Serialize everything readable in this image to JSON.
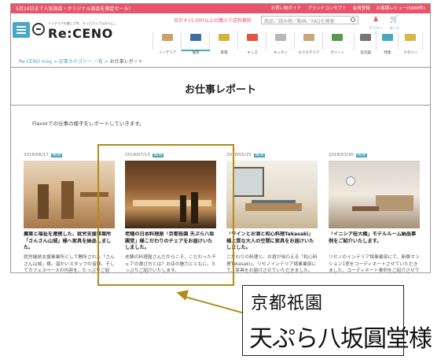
{
  "topbar": {
    "promo": "5月10日まで人気商品・オリジナル商品を限定セール！",
    "links": [
      "お買い物ガイド",
      "ブランドコンセプト",
      "会員登録",
      "お客様レビュー(5888件)"
    ]
  },
  "header": {
    "logo_tagline": "インテリアの楽しさを、もっとたくさんの人に。",
    "logo_text": "Re:CENO",
    "shipping_note": "合計￥15,000以上の購入で送料無料",
    "search_placeholder": "商品／読み物／動画／FAQを検索",
    "mypage_label": "マイページ",
    "cart_label": "カート"
  },
  "categories": [
    {
      "label": "インテリア",
      "color": "#c8a46a"
    },
    {
      "label": "寝具",
      "color": "#3d6fa3"
    },
    {
      "label": "家電",
      "color": "#d8b33c"
    },
    {
      "label": "キッズ",
      "color": "#e0563f"
    },
    {
      "label": "キッチン",
      "color": "#b8b8b8"
    },
    {
      "label": "エクステリア",
      "color": "#c9a97a"
    },
    {
      "label": "グリーン",
      "color": "#5a9a4a"
    },
    {
      "label": "実店舗",
      "color": "#777777"
    },
    {
      "label": "特集",
      "color": "#4aa6c9"
    },
    {
      "label": "マガジン",
      "color": "#d4b84a"
    }
  ],
  "breadcrumb": {
    "home": "Re:CENO mag",
    "category": "記事カテゴリー 一覧",
    "current": "お仕事レポート"
  },
  "page_title": "お仕事レポート",
  "intro": "Flavorでの仕事の様子をレポートしていきます。",
  "articles": [
    {
      "date": "2018/06/17",
      "badge": "NEW",
      "title": "農業と福祉を連携した、就労支援事業所「さんさん山城」様へ家具を納品しました。",
      "desc": "就労継続支援事業所として開所された「さんさん山城」様。温かいスタッフの皆様、そしてカフェスペースの内容を、たっぷりご紹介..."
    },
    {
      "date": "2018/07/13",
      "badge": "NEW",
      "title": "老舗の日本料理屋「京都祇園 天ぷら八坂圓堂」様こだわりのチェアをお届けいたしました。",
      "desc": "老舗の料理屋さんだからこそ、こだわったチェアの選び方とは？お店の魅力とともに、たっぷりご紹介いたします。"
    },
    {
      "date": "2018/05/25",
      "badge": "NEW",
      "title": "「ワインとお酒と和心料理Takasaki」様上質な大人の空間に家具をお届けいたしました。",
      "desc": "こだわりの料理と、お酒が味わえる「和心料理Takasaki」。リセノインテリア請事業部にて、家具をお届けさせていただきました。"
    },
    {
      "date": "2018/03/30",
      "badge": "NEW",
      "title": "「イニシア桂大橋」モデルルーム納品事例をご紹介いたします。",
      "desc": "リセノのインテリア請事業部にて、新築マンション1室をコーディネートさせていただきました。コーディネート事例をご紹介させていただきます。"
    }
  ],
  "callout": {
    "line1": "京都祇園",
    "line2": "天ぷら八坂圓堂様",
    "highlight_color": "#b48a1a"
  }
}
